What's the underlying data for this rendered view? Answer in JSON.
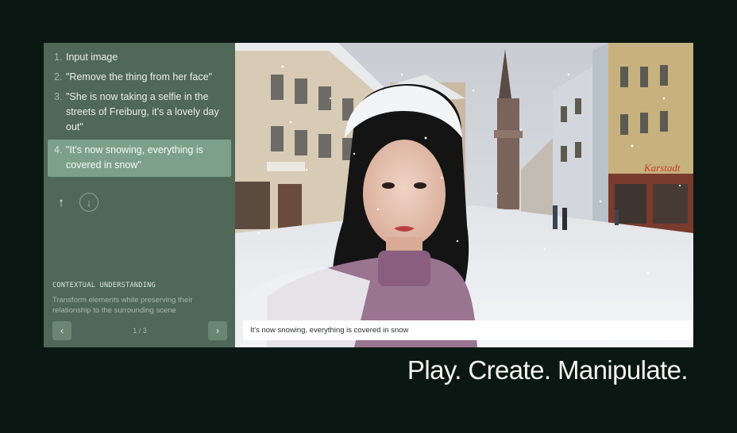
{
  "steps": [
    {
      "num": "1.",
      "text": "Input image"
    },
    {
      "num": "2.",
      "text": "\"Remove the thing from her face\""
    },
    {
      "num": "3.",
      "text": "\"She is now taking a selfie in the streets of Freiburg, it's a lovely day out\""
    },
    {
      "num": "4.",
      "text": "\"It's now snowing, everything is covered in snow\""
    }
  ],
  "nav": {
    "up_icon": "↑",
    "down_icon": "↓"
  },
  "context": {
    "heading": "CONTEXTUAL UNDERSTANDING",
    "description": "Transform elements while preserving their relationship to the surrounding scene"
  },
  "pager": {
    "prev_icon": "‹",
    "next_icon": "›",
    "count": "1 / 3"
  },
  "image": {
    "prompt_value": "It's now snowing, everything is covered in snow",
    "shop_sign": "Karstadt"
  },
  "tagline": "Play. Create. Manipulate."
}
